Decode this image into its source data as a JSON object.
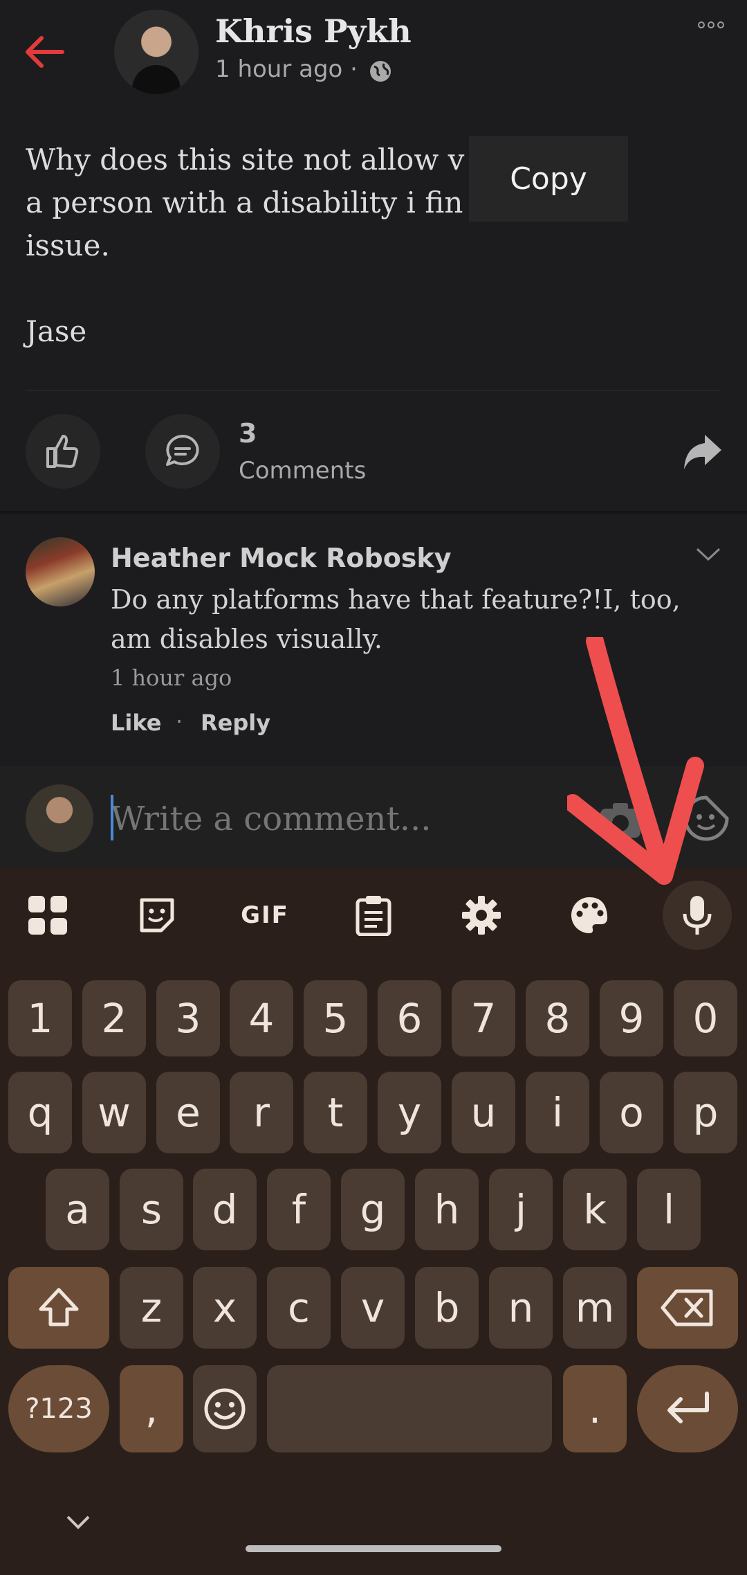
{
  "post": {
    "author_name": "Khris Pykh",
    "time": "1 hour ago ·",
    "body": "Why does this site not allow v      g, as\na person with a disability i fin           e an\nissue.\n\nJase",
    "copy_popup_label": "Copy",
    "comment_count": "3",
    "comment_label": "Comments"
  },
  "comment": {
    "name": "Heather Mock Robosky",
    "text": "Do any platforms have that feature?!I, too, am disables visually.",
    "time": "1 hour ago",
    "like_label": "Like",
    "separator": "·",
    "reply_label": "Reply"
  },
  "composer": {
    "placeholder": "Write a comment..."
  },
  "keyboard": {
    "number_row": [
      "1",
      "2",
      "3",
      "4",
      "5",
      "6",
      "7",
      "8",
      "9",
      "0"
    ],
    "row1": [
      "q",
      "w",
      "e",
      "r",
      "t",
      "y",
      "u",
      "i",
      "o",
      "p"
    ],
    "row2": [
      "a",
      "s",
      "d",
      "f",
      "g",
      "h",
      "j",
      "k",
      "l"
    ],
    "row3": [
      "z",
      "x",
      "c",
      "v",
      "b",
      "n",
      "m"
    ],
    "symbols_label": "?123",
    "comma_label": ",",
    "period_label": ".",
    "gif_label": "GIF"
  },
  "colors": {
    "accent_back": "#e23b3b",
    "annotation_arrow": "#ef4e4e",
    "keyboard_bg": "#2a1f1a"
  },
  "icons": [
    "back-arrow-icon",
    "globe-icon",
    "more-icon",
    "like-icon",
    "comment-icon",
    "share-icon",
    "chevron-down-icon",
    "camera-icon",
    "sticker-icon",
    "apps-grid-icon",
    "emoji-sticker-icon",
    "gif-icon",
    "clipboard-icon",
    "settings-icon",
    "palette-icon",
    "microphone-icon",
    "shift-icon",
    "backspace-icon",
    "emoji-icon",
    "enter-icon"
  ]
}
